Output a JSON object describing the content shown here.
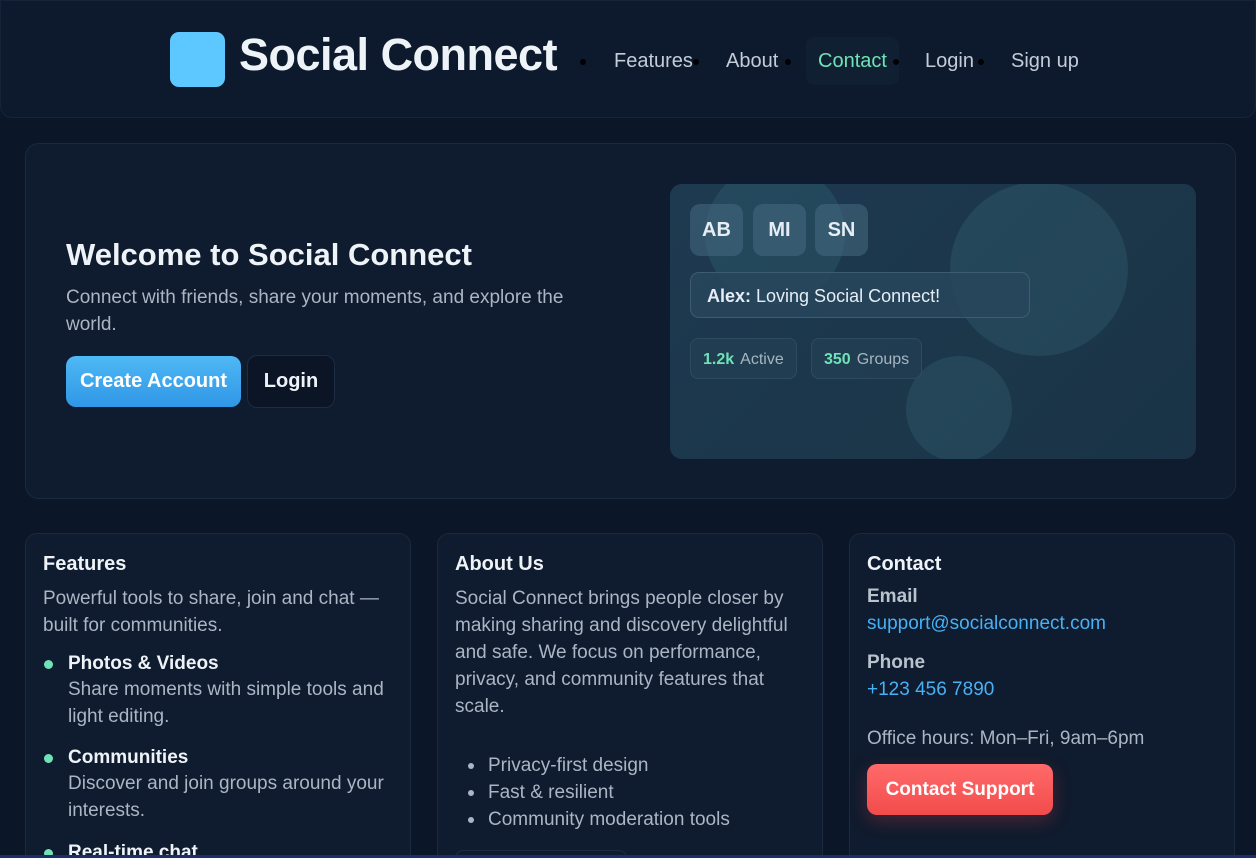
{
  "brand": {
    "name": "Social Connect"
  },
  "nav": {
    "items": [
      {
        "label": "Features"
      },
      {
        "label": "About"
      },
      {
        "label": "Contact",
        "active": true
      },
      {
        "label": "Login"
      },
      {
        "label": "Sign up"
      }
    ]
  },
  "hero": {
    "title": "Welcome to Social Connect",
    "subtitle": "Connect with friends, share your moments, and explore the world.",
    "primary_button": "Create Account",
    "secondary_button": "Login",
    "preview": {
      "avatars": [
        "AB",
        "MI",
        "SN"
      ],
      "message_author": "Alex:",
      "message_text": " Loving Social Connect!",
      "stats": [
        {
          "value": "1.2k",
          "label": "Active"
        },
        {
          "value": "350",
          "label": "Groups"
        }
      ]
    }
  },
  "features": {
    "title": "Features",
    "intro": "Powerful tools to share, join and chat — built for communities.",
    "items": [
      {
        "title": "Photos & Videos",
        "desc": "Share moments with simple tools and light editing."
      },
      {
        "title": "Communities",
        "desc": "Discover and join groups around your interests."
      },
      {
        "title": "Real-time chat",
        "desc": ""
      }
    ]
  },
  "about": {
    "title": "About Us",
    "text": "Social Connect brings people closer by making sharing and discovery delightful and safe. We focus on performance, privacy, and community features that scale.",
    "bullets": [
      "Privacy-first design",
      "Fast & resilient",
      "Community moderation tools"
    ]
  },
  "contact": {
    "title": "Contact",
    "email_label": "Email",
    "email": "support@socialconnect.com",
    "phone_label": "Phone",
    "phone": "+123 456 7890",
    "hours": "Office hours: Mon–Fri, 9am–6pm",
    "button": "Contact Support"
  },
  "colors": {
    "background": "#0b1628",
    "accent": "#5cc8ff",
    "active_nav": "#6fe3b6",
    "primary_button": "#3aa6ee",
    "contact_button": "#f55555",
    "link": "#48b0f5"
  }
}
